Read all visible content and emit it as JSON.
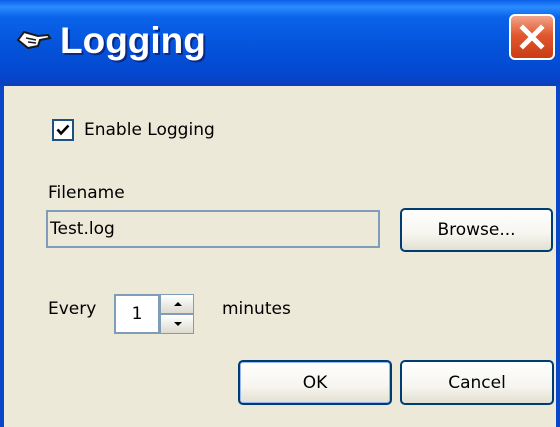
{
  "window": {
    "title": "Logging",
    "title_icon": "pointing-hand-icon",
    "close_icon": "close-icon",
    "colors": {
      "titlebar": "#0453da",
      "close_button": "#e2582e",
      "face": "#ece9d8",
      "border": "#003c74"
    }
  },
  "logging": {
    "enable_label": "Enable Logging",
    "enable_checked": true
  },
  "filename": {
    "label": "Filename",
    "value": "Test.log"
  },
  "buttons": {
    "browse_label": "Browse...",
    "ok_label": "OK",
    "cancel_label": "Cancel"
  },
  "interval": {
    "prefix": "Every",
    "value": "1",
    "suffix": "minutes"
  }
}
